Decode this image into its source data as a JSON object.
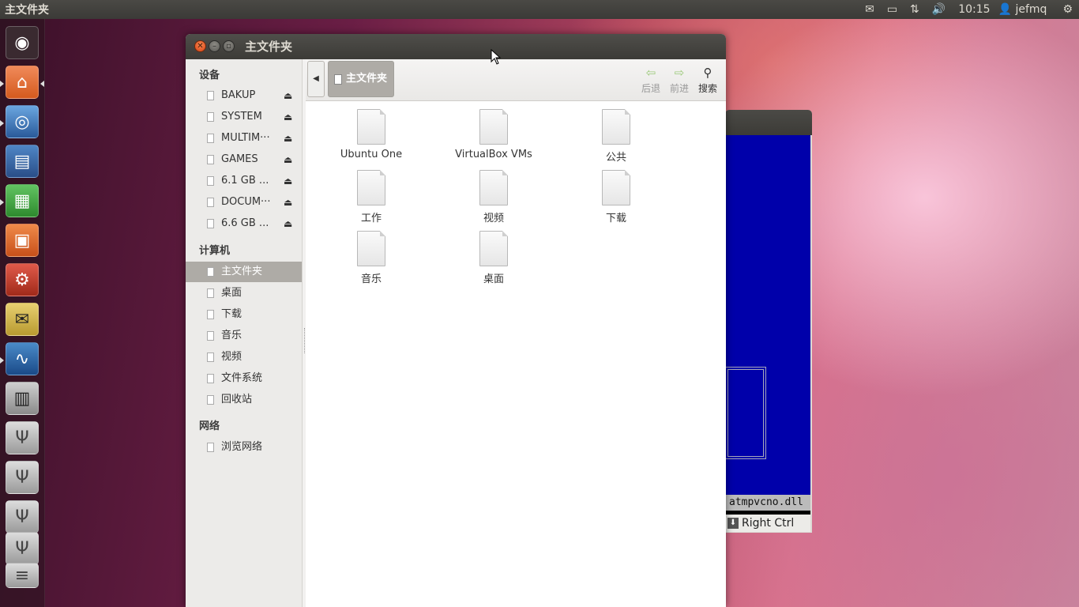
{
  "top_panel": {
    "app_title": "主文件夹",
    "clock": "10:15",
    "user": "jefmq",
    "tray_icons": [
      "mail-icon",
      "battery-icon",
      "network-icon",
      "volume-icon"
    ]
  },
  "launcher": {
    "items": [
      "dash-home-icon",
      "home-folder-icon",
      "chromium-icon",
      "writer-icon",
      "calc-icon",
      "ubuntu-software-icon",
      "system-settings-icon",
      "pidgin-icon",
      "system-monitor-icon",
      "workspace-switcher-icon",
      "usb-drive-icon",
      "usb-drive-icon",
      "usb-drive-icon",
      "usb-drive-icon",
      "usb-drive-icon"
    ]
  },
  "vbox_window": {
    "file_label": "atmpvcno.dll",
    "status_label": "Right Ctrl"
  },
  "window": {
    "title": "主文件夹",
    "sidebar": {
      "devices_heading": "设备",
      "devices": [
        {
          "label": "BAKUP"
        },
        {
          "label": "SYSTEM"
        },
        {
          "label": "MULTIM···"
        },
        {
          "label": "GAMES"
        },
        {
          "label": "6.1 GB ..."
        },
        {
          "label": "DOCUM···"
        },
        {
          "label": "6.6 GB ..."
        }
      ],
      "computer_heading": "计算机",
      "places": [
        {
          "label": "主文件夹",
          "selected": true
        },
        {
          "label": "桌面"
        },
        {
          "label": "下载"
        },
        {
          "label": "音乐"
        },
        {
          "label": "视频"
        },
        {
          "label": "文件系统"
        },
        {
          "label": "回收站"
        }
      ],
      "network_heading": "网络",
      "network": [
        {
          "label": "浏览网络"
        }
      ]
    },
    "toolbar": {
      "breadcrumb": "主文件夹",
      "back_label": "后退",
      "forward_label": "前进",
      "search_label": "搜索"
    },
    "files": [
      {
        "name": "Ubuntu One"
      },
      {
        "name": "VirtualBox VMs"
      },
      {
        "name": "公共"
      },
      {
        "name": "工作"
      },
      {
        "name": "视频"
      },
      {
        "name": "下载"
      },
      {
        "name": "音乐"
      },
      {
        "name": "桌面"
      }
    ]
  }
}
